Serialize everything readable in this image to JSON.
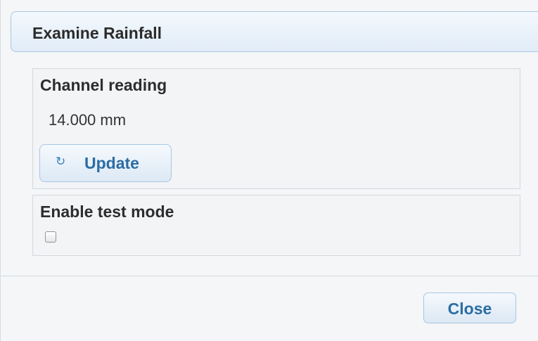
{
  "dialog": {
    "title": "Examine Rainfall"
  },
  "channel_reading": {
    "title": "Channel reading",
    "value": "14.000 mm",
    "update_icon": "refresh-icon",
    "update_label": "Update"
  },
  "test_mode": {
    "title": "Enable test mode",
    "checked": false
  },
  "footer": {
    "close_label": "Close"
  },
  "colors": {
    "accent": "#2c6da3",
    "border": "#a9c6e2",
    "background": "#f4f6f8"
  }
}
